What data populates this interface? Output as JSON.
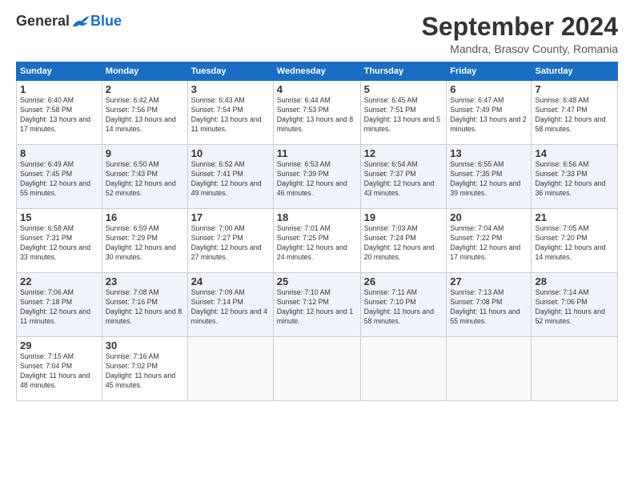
{
  "logo": {
    "general": "General",
    "blue": "Blue"
  },
  "title": "September 2024",
  "subtitle": "Mandra, Brasov County, Romania",
  "days": [
    "Sunday",
    "Monday",
    "Tuesday",
    "Wednesday",
    "Thursday",
    "Friday",
    "Saturday"
  ],
  "weeks": [
    [
      {
        "day": "1",
        "info": "Sunrise: 6:40 AM\nSunset: 7:58 PM\nDaylight: 13 hours and 17 minutes."
      },
      {
        "day": "2",
        "info": "Sunrise: 6:42 AM\nSunset: 7:56 PM\nDaylight: 13 hours and 14 minutes."
      },
      {
        "day": "3",
        "info": "Sunrise: 6:43 AM\nSunset: 7:54 PM\nDaylight: 13 hours and 11 minutes."
      },
      {
        "day": "4",
        "info": "Sunrise: 6:44 AM\nSunset: 7:53 PM\nDaylight: 13 hours and 8 minutes."
      },
      {
        "day": "5",
        "info": "Sunrise: 6:45 AM\nSunset: 7:51 PM\nDaylight: 13 hours and 5 minutes."
      },
      {
        "day": "6",
        "info": "Sunrise: 6:47 AM\nSunset: 7:49 PM\nDaylight: 13 hours and 2 minutes."
      },
      {
        "day": "7",
        "info": "Sunrise: 6:48 AM\nSunset: 7:47 PM\nDaylight: 12 hours and 58 minutes."
      }
    ],
    [
      {
        "day": "8",
        "info": "Sunrise: 6:49 AM\nSunset: 7:45 PM\nDaylight: 12 hours and 55 minutes."
      },
      {
        "day": "9",
        "info": "Sunrise: 6:50 AM\nSunset: 7:43 PM\nDaylight: 12 hours and 52 minutes."
      },
      {
        "day": "10",
        "info": "Sunrise: 6:52 AM\nSunset: 7:41 PM\nDaylight: 12 hours and 49 minutes."
      },
      {
        "day": "11",
        "info": "Sunrise: 6:53 AM\nSunset: 7:39 PM\nDaylight: 12 hours and 46 minutes."
      },
      {
        "day": "12",
        "info": "Sunrise: 6:54 AM\nSunset: 7:37 PM\nDaylight: 12 hours and 43 minutes."
      },
      {
        "day": "13",
        "info": "Sunrise: 6:55 AM\nSunset: 7:35 PM\nDaylight: 12 hours and 39 minutes."
      },
      {
        "day": "14",
        "info": "Sunrise: 6:56 AM\nSunset: 7:33 PM\nDaylight: 12 hours and 36 minutes."
      }
    ],
    [
      {
        "day": "15",
        "info": "Sunrise: 6:58 AM\nSunset: 7:31 PM\nDaylight: 12 hours and 33 minutes."
      },
      {
        "day": "16",
        "info": "Sunrise: 6:59 AM\nSunset: 7:29 PM\nDaylight: 12 hours and 30 minutes."
      },
      {
        "day": "17",
        "info": "Sunrise: 7:00 AM\nSunset: 7:27 PM\nDaylight: 12 hours and 27 minutes."
      },
      {
        "day": "18",
        "info": "Sunrise: 7:01 AM\nSunset: 7:25 PM\nDaylight: 12 hours and 24 minutes."
      },
      {
        "day": "19",
        "info": "Sunrise: 7:03 AM\nSunset: 7:24 PM\nDaylight: 12 hours and 20 minutes."
      },
      {
        "day": "20",
        "info": "Sunrise: 7:04 AM\nSunset: 7:22 PM\nDaylight: 12 hours and 17 minutes."
      },
      {
        "day": "21",
        "info": "Sunrise: 7:05 AM\nSunset: 7:20 PM\nDaylight: 12 hours and 14 minutes."
      }
    ],
    [
      {
        "day": "22",
        "info": "Sunrise: 7:06 AM\nSunset: 7:18 PM\nDaylight: 12 hours and 11 minutes."
      },
      {
        "day": "23",
        "info": "Sunrise: 7:08 AM\nSunset: 7:16 PM\nDaylight: 12 hours and 8 minutes."
      },
      {
        "day": "24",
        "info": "Sunrise: 7:09 AM\nSunset: 7:14 PM\nDaylight: 12 hours and 4 minutes."
      },
      {
        "day": "25",
        "info": "Sunrise: 7:10 AM\nSunset: 7:12 PM\nDaylight: 12 hours and 1 minute."
      },
      {
        "day": "26",
        "info": "Sunrise: 7:11 AM\nSunset: 7:10 PM\nDaylight: 11 hours and 58 minutes."
      },
      {
        "day": "27",
        "info": "Sunrise: 7:13 AM\nSunset: 7:08 PM\nDaylight: 11 hours and 55 minutes."
      },
      {
        "day": "28",
        "info": "Sunrise: 7:14 AM\nSunset: 7:06 PM\nDaylight: 11 hours and 52 minutes."
      }
    ],
    [
      {
        "day": "29",
        "info": "Sunrise: 7:15 AM\nSunset: 7:04 PM\nDaylight: 11 hours and 48 minutes."
      },
      {
        "day": "30",
        "info": "Sunrise: 7:16 AM\nSunset: 7:02 PM\nDaylight: 11 hours and 45 minutes."
      },
      null,
      null,
      null,
      null,
      null
    ]
  ]
}
